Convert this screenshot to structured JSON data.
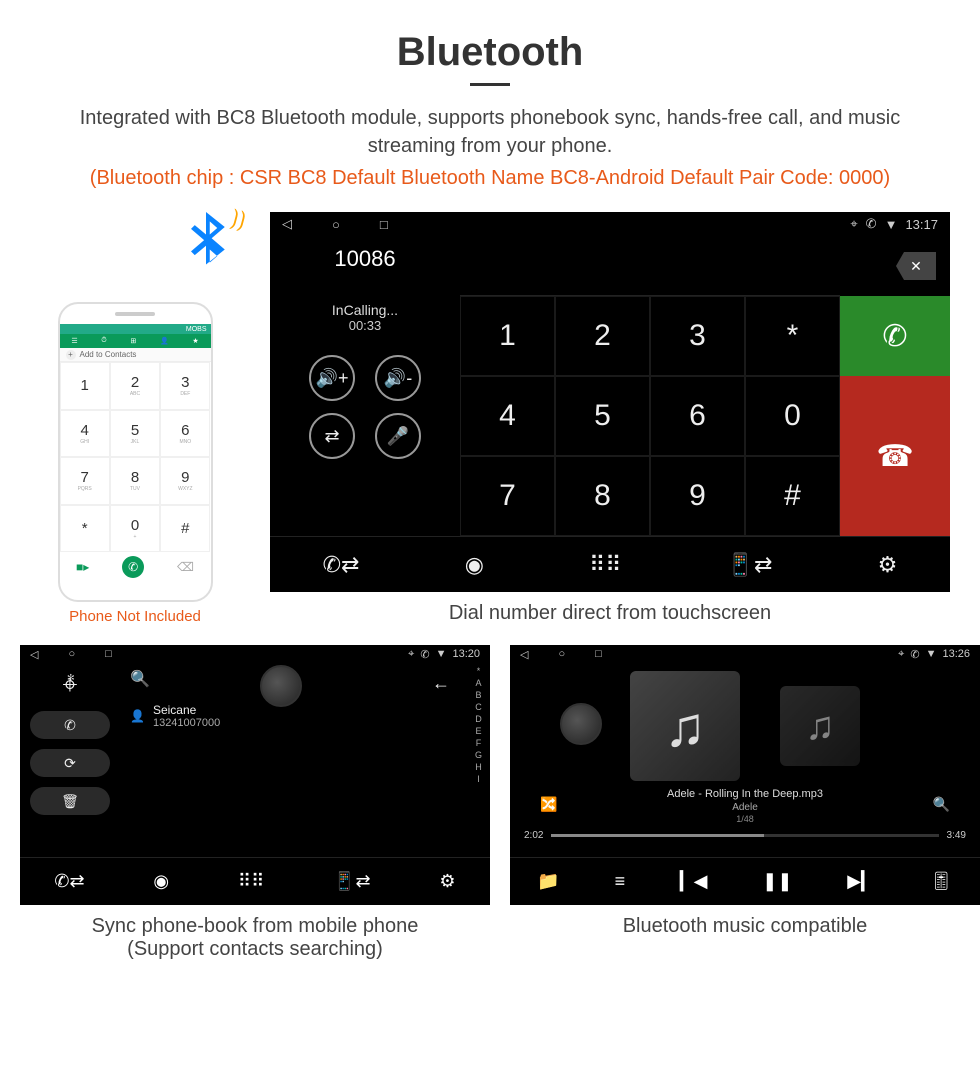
{
  "header": {
    "title": "Bluetooth",
    "subtitle": "Integrated with BC8 Bluetooth module, supports phonebook sync, hands-free call, and music streaming from your phone.",
    "spec": "(Bluetooth chip : CSR BC8    Default Bluetooth Name BC8-Android    Default Pair Code: 0000)"
  },
  "phone_mock": {
    "not_included": "Phone Not Included",
    "status_time": "MOBS",
    "add_contacts": "Add to Contacts",
    "keys": [
      {
        "n": "1",
        "l": ""
      },
      {
        "n": "2",
        "l": "ABC"
      },
      {
        "n": "3",
        "l": "DEF"
      },
      {
        "n": "4",
        "l": "GHI"
      },
      {
        "n": "5",
        "l": "JKL"
      },
      {
        "n": "6",
        "l": "MNO"
      },
      {
        "n": "7",
        "l": "PQRS"
      },
      {
        "n": "8",
        "l": "TUV"
      },
      {
        "n": "9",
        "l": "WXYZ"
      },
      {
        "n": "*",
        "l": ""
      },
      {
        "n": "0",
        "l": "+"
      },
      {
        "n": "#",
        "l": ""
      }
    ]
  },
  "dialer": {
    "caption": "Dial number direct from touchscreen",
    "status_time": "13:17",
    "typed_number": "10086",
    "call_status": "InCalling...",
    "call_duration": "00:33",
    "keys_row1": [
      "1",
      "2",
      "3",
      "*"
    ],
    "keys_row2": [
      "4",
      "5",
      "6",
      "0"
    ],
    "keys_row3": [
      "7",
      "8",
      "9",
      "#"
    ]
  },
  "phonebook": {
    "caption1": "Sync phone-book from mobile phone",
    "caption2": "(Support contacts searching)",
    "status_time": "13:20",
    "contact_name": "Seicane",
    "contact_number": "13241007000",
    "index": [
      "*",
      "A",
      "B",
      "C",
      "D",
      "E",
      "F",
      "G",
      "H",
      "I"
    ]
  },
  "music": {
    "caption": "Bluetooth music compatible",
    "status_time": "13:26",
    "track_file": "Adele - Rolling In the Deep.mp3",
    "artist": "Adele",
    "track_num": "1/48",
    "elapsed": "2:02",
    "total": "3:49"
  }
}
